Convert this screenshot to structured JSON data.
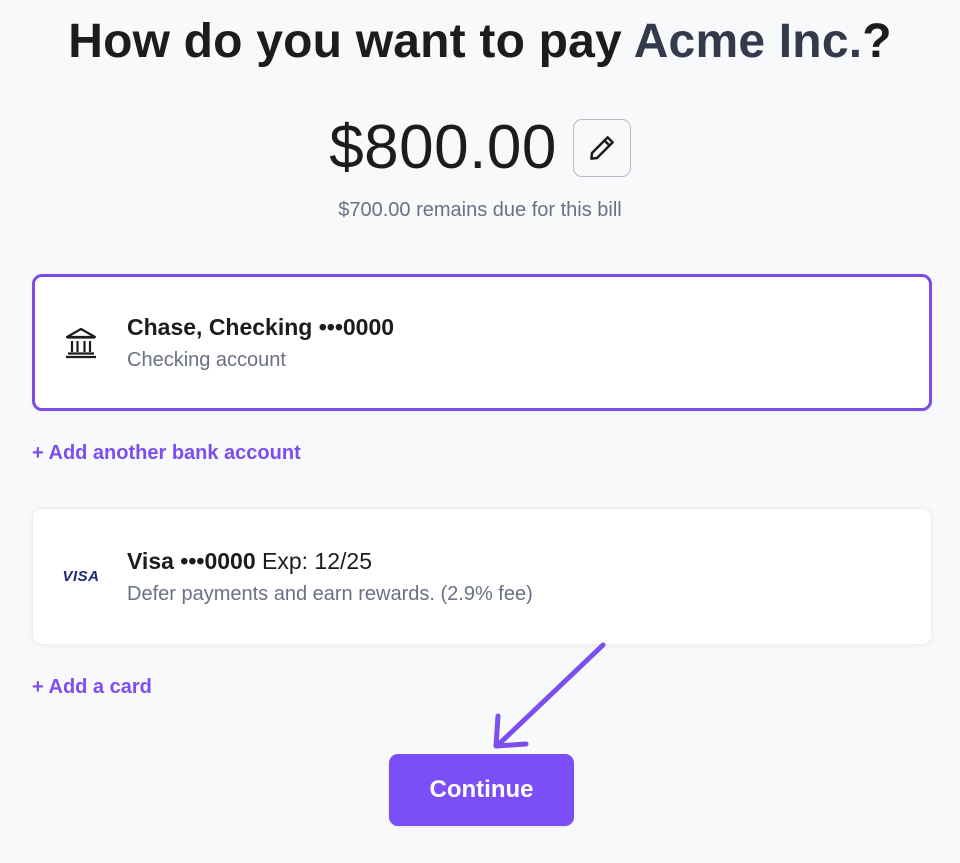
{
  "header": {
    "prefix": "How do you want to pay ",
    "payee": "Acme Inc.",
    "suffix": "?"
  },
  "amount": {
    "value": "$800.00",
    "remaining_text": "$700.00 remains due for this bill"
  },
  "payment_methods": [
    {
      "type": "bank",
      "icon": "bank-icon",
      "title": "Chase, Checking •••0000",
      "subtitle": "Checking account",
      "selected": true
    },
    {
      "type": "card",
      "icon": "visa-logo",
      "brand_text": "VISA",
      "title": "Visa •••0000",
      "expiry": " Exp: 12/25",
      "subtitle": "Defer payments and earn rewards. (2.9% fee)",
      "selected": false
    }
  ],
  "links": {
    "add_bank": "+ Add another bank account",
    "add_card": "+ Add a card"
  },
  "actions": {
    "continue_label": "Continue"
  },
  "colors": {
    "accent": "#7c4ef8",
    "selected_border": "#7b4ce6",
    "payee_text": "#323a4c",
    "muted_text": "#6a7184",
    "background": "#f8f9fb"
  }
}
